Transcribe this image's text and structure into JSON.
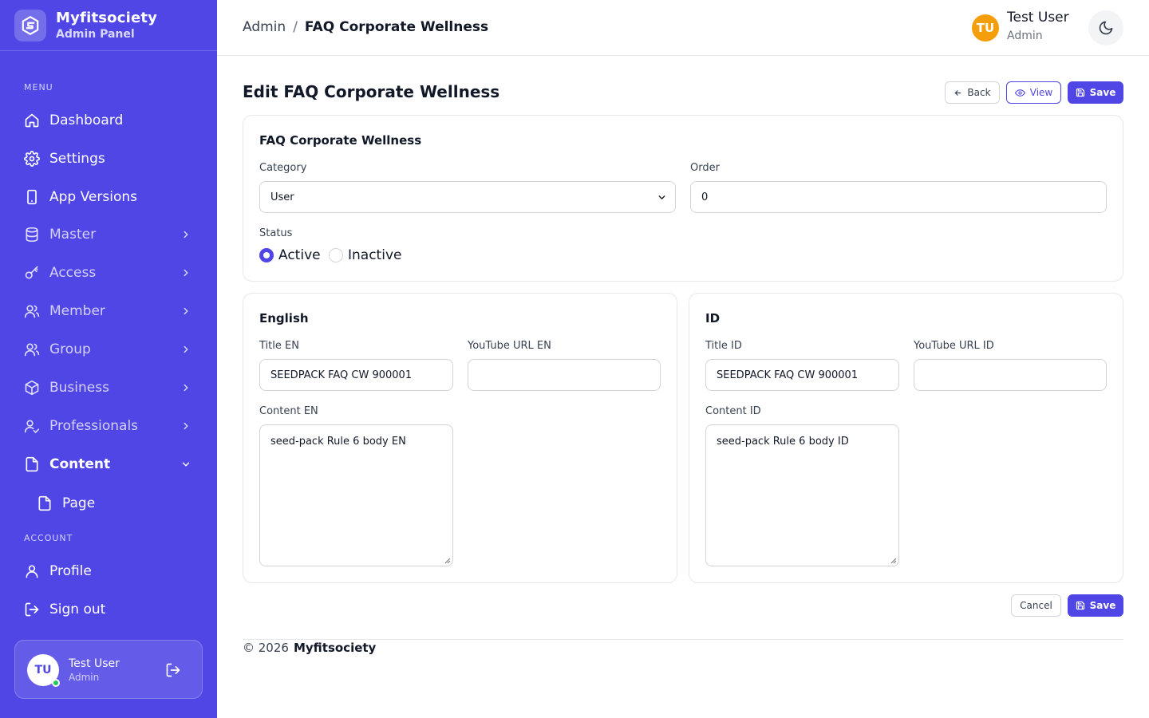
{
  "brand": {
    "name": "Myfitsociety",
    "subtitle": "Admin Panel"
  },
  "sidebar": {
    "menu_label": "MENU",
    "items": [
      {
        "label": "Dashboard",
        "icon": "home-icon"
      },
      {
        "label": "Settings",
        "icon": "gear-icon"
      },
      {
        "label": "App Versions",
        "icon": "smartphone-icon"
      },
      {
        "label": "Master",
        "icon": "database-icon"
      },
      {
        "label": "Access",
        "icon": "key-icon"
      },
      {
        "label": "Member",
        "icon": "users-icon"
      },
      {
        "label": "Group",
        "icon": "group-icon"
      },
      {
        "label": "Business",
        "icon": "box-icon"
      },
      {
        "label": "Professionals",
        "icon": "user-check-icon"
      },
      {
        "label": "Content",
        "icon": "file-icon"
      },
      {
        "label": "Page",
        "icon": "file-icon"
      }
    ],
    "account_label": "ACCOUNT",
    "account_items": [
      {
        "label": "Profile",
        "icon": "user-icon"
      },
      {
        "label": "Sign out",
        "icon": "logout-icon"
      }
    ],
    "user_card": {
      "initials": "TU",
      "name": "Test User",
      "role": "Admin"
    }
  },
  "header": {
    "breadcrumb": [
      "Admin",
      "/",
      "FAQ Corporate Wellness"
    ],
    "user": {
      "initials": "TU",
      "name": "Test User",
      "role": "Admin"
    }
  },
  "page": {
    "title": "Edit FAQ Corporate Wellness",
    "back_label": "Back",
    "view_label": "View",
    "save_label": "Save",
    "cancel_label": "Cancel"
  },
  "general_card": {
    "title": "FAQ Corporate Wellness",
    "category_label": "Category",
    "category_value": "User",
    "order_label": "Order",
    "order_value": "0",
    "status_label": "Status",
    "status_options": [
      "Active",
      "Inactive"
    ],
    "status_selected": "Active"
  },
  "english_card": {
    "title": "English",
    "title_label": "Title EN",
    "title_value": "SEEDPACK FAQ CW 900001",
    "youtube_label": "YouTube URL EN",
    "youtube_value": "",
    "content_label": "Content EN",
    "content_value": "seed-pack Rule 6 body EN"
  },
  "id_card": {
    "title": "ID",
    "title_label": "Title ID",
    "title_value": "SEEDPACK FAQ CW 900001",
    "youtube_label": "YouTube URL ID",
    "youtube_value": "",
    "content_label": "Content ID",
    "content_value": "seed-pack Rule 6 body ID"
  },
  "footer": {
    "copyright": "© 2026",
    "brand": "Myfitsociety"
  },
  "colors": {
    "primary": "#4f46e5",
    "avatar": "#f59e0b",
    "online": "#22c55e"
  }
}
